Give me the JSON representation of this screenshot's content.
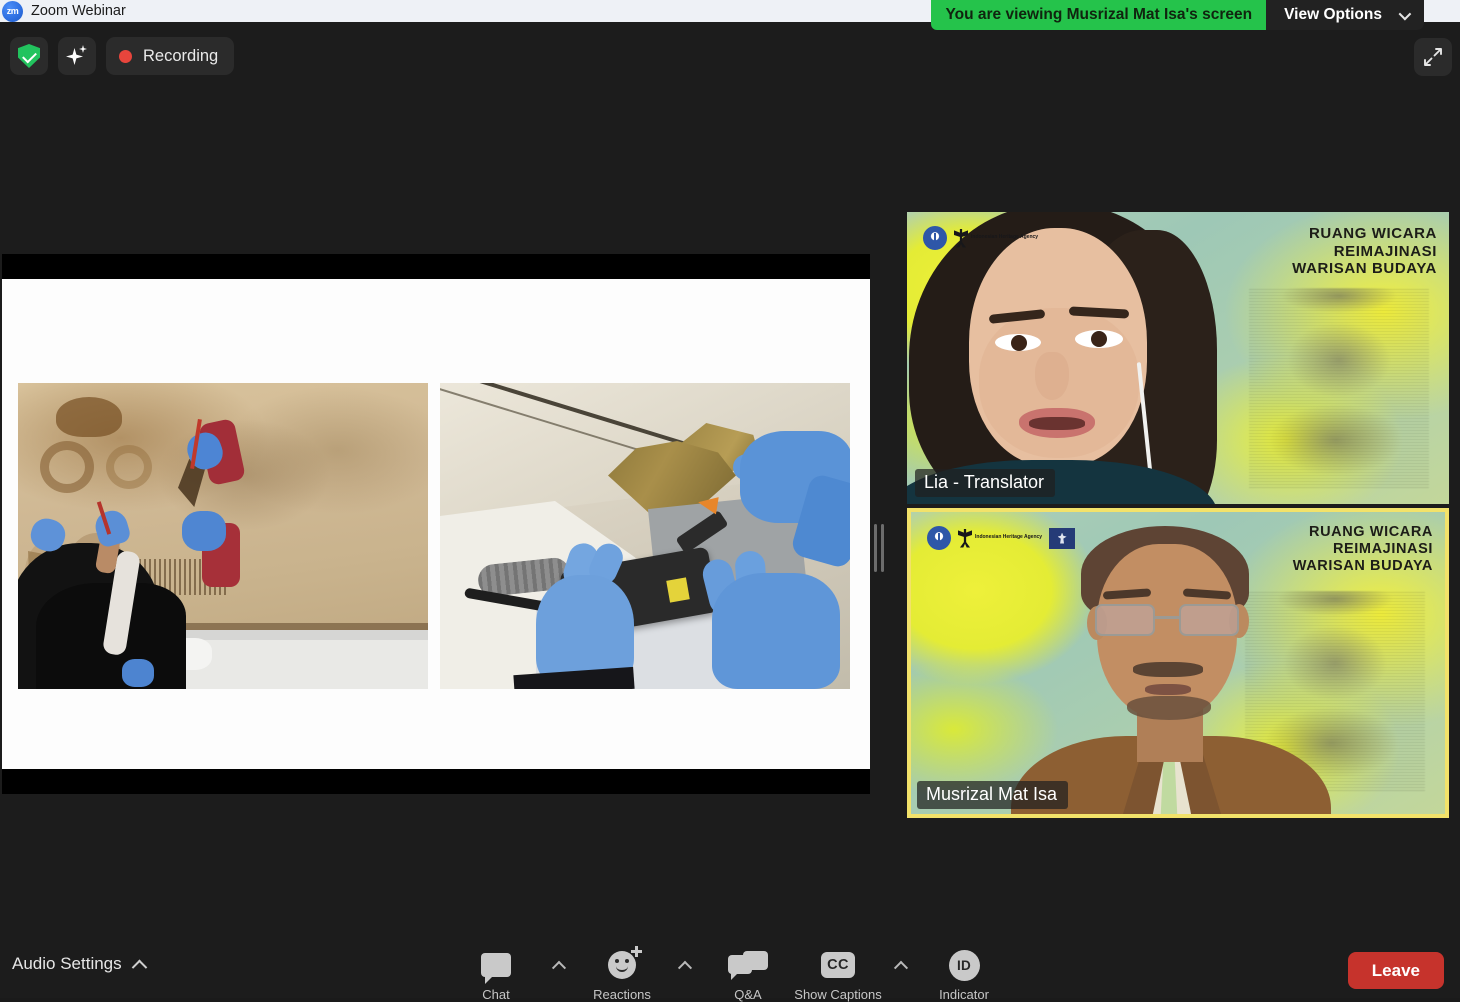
{
  "window": {
    "title": "Zoom Webinar",
    "logo_text": "zm",
    "logo_icon": "zoom-logo-icon"
  },
  "status_bar": {
    "encryption_icon": "green-shield-check-icon",
    "ai_companion_icon": "sparkle-icon",
    "recording_label": "Recording",
    "recording_dot_color": "#e8453c",
    "shield_color": "#22c35e"
  },
  "share_banner": {
    "status_text": "You are viewing Musrizal Mat Isa's screen",
    "view_options_label": "View Options",
    "chevron_icon": "chevron-down-icon",
    "banner_color": "#25c34b"
  },
  "expand": {
    "icon": "expand-fullscreen-icon"
  },
  "shared_screen": {
    "presenter": "Musrizal Mat Isa",
    "slide_description": "Two side-by-side conservation photographs",
    "photos": [
      {
        "name": "conservators-cleaning-painted-textile",
        "caption": "Conservators in blue nitrile gloves treating a painted textile laid on a white table"
      },
      {
        "name": "laser-cleaning-close-up",
        "caption": "Close-up of gloved hands operating a handheld laser cleaning device on a damaged artefact"
      }
    ]
  },
  "drag_handle": {
    "name": "panel-resize-handle"
  },
  "gallery": {
    "virtual_background_title": "RUANG WICARA\nREIMAJINASI\nWARISAN BUDAYA",
    "bg_line_1": "RUANG WICARA",
    "bg_line_2": "REIMAJINASI",
    "bg_line_3": "WARISAN BUDAYA",
    "active_speaker_border_color": "#f2e26a",
    "tiles": [
      {
        "name": "Lia - Translator",
        "active_speaker": false,
        "logos": [
          "garuda-ministry-logo",
          "indonesian-heritage-agency-logo"
        ],
        "logo_text": "Indonesian\nHeritage\nAgency"
      },
      {
        "name": "Musrizal Mat Isa",
        "active_speaker": true,
        "logos": [
          "garuda-ministry-logo",
          "indonesian-heritage-agency-logo",
          "partner-badge-logo"
        ],
        "logo_text": "Indonesian\nHeritage\nAgency"
      }
    ]
  },
  "toolbar": {
    "audio_settings_label": "Audio Settings",
    "audio_settings_caret_icon": "chevron-up-icon",
    "items": [
      {
        "label": "Chat",
        "icon": "chat-bubble-icon",
        "has_caret": true
      },
      {
        "label": "Reactions",
        "icon": "reactions-smiley-icon",
        "has_caret": true
      },
      {
        "label": "Q&A",
        "icon": "qa-double-bubble-icon",
        "has_caret": false
      },
      {
        "label": "Show Captions",
        "icon": "closed-caption-icon",
        "has_caret": true,
        "badge": "CC"
      },
      {
        "label": "Indicator",
        "icon": "id-badge-icon",
        "has_caret": false,
        "badge": "ID"
      }
    ],
    "leave_label": "Leave",
    "leave_color": "#c6332c"
  }
}
